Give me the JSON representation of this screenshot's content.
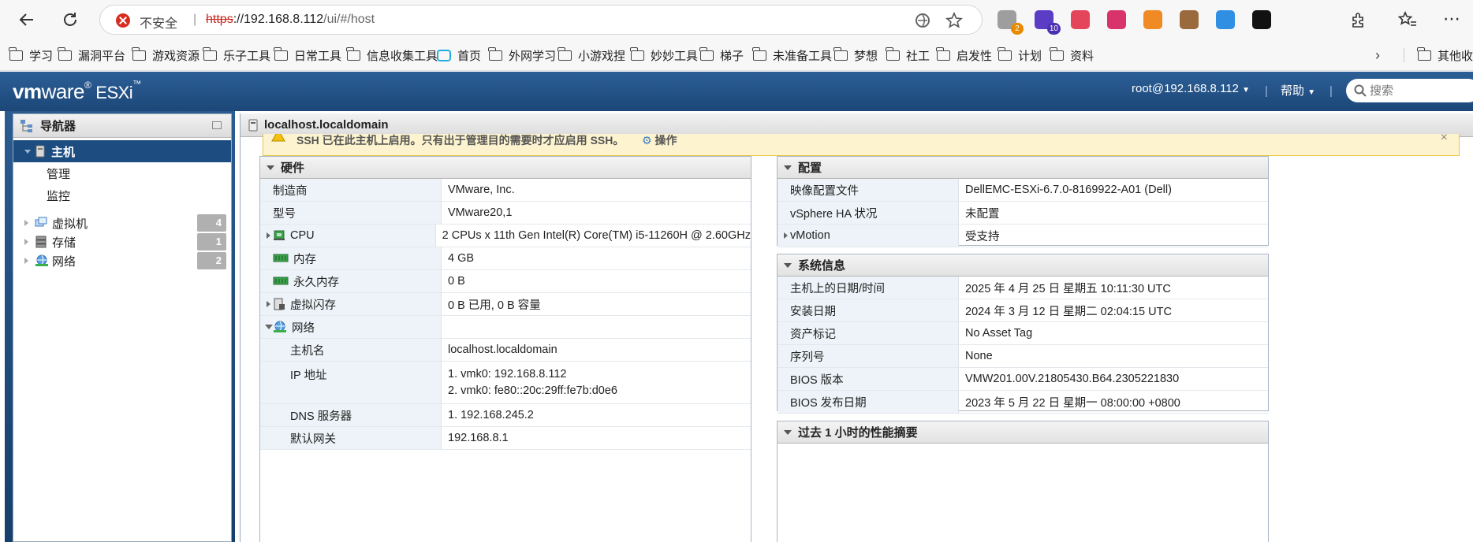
{
  "browser": {
    "insecure_label": "不安全",
    "url_scheme": "https",
    "url_host": "://192.168.8.112",
    "url_path": "/ui/#/host",
    "extensions": [
      {
        "name": "puzzle-gray",
        "badge": "2",
        "color": "#9e9e9e",
        "badge_color": "#e88a00"
      },
      {
        "name": "graduation",
        "badge": "10",
        "color": "#5b3cc4",
        "badge_color": "#4a2fb0"
      },
      {
        "name": "yd",
        "badge": "",
        "color": "#e5455a",
        "badge_color": ""
      },
      {
        "name": "translate",
        "badge": "",
        "color": "#d9336b",
        "badge_color": ""
      },
      {
        "name": "fox",
        "badge": "",
        "color": "#f08a24",
        "badge_color": ""
      },
      {
        "name": "cookie",
        "badge": "",
        "color": "#9a6a3c",
        "badge_color": ""
      },
      {
        "name": "pie",
        "badge": "",
        "color": "#2f8fe3",
        "badge_color": ""
      },
      {
        "name": "ghost",
        "badge": "",
        "color": "#111111",
        "badge_color": ""
      }
    ]
  },
  "bookmarks": [
    {
      "label": "学习",
      "icon": "folder"
    },
    {
      "label": "漏洞平台",
      "icon": "folder"
    },
    {
      "label": "游戏资源",
      "icon": "folder"
    },
    {
      "label": "乐子工具",
      "icon": "folder"
    },
    {
      "label": "日常工具",
      "icon": "folder"
    },
    {
      "label": "信息收集工具",
      "icon": "folder"
    },
    {
      "label": "首页",
      "icon": "bilibili"
    },
    {
      "label": "外网学习",
      "icon": "folder"
    },
    {
      "label": "小游戏捏",
      "icon": "folder"
    },
    {
      "label": "妙妙工具",
      "icon": "folder"
    },
    {
      "label": "梯子",
      "icon": "folder"
    },
    {
      "label": "未准备工具",
      "icon": "folder"
    },
    {
      "label": "梦想",
      "icon": "folder"
    },
    {
      "label": "社工",
      "icon": "folder"
    },
    {
      "label": "启发性",
      "icon": "folder"
    },
    {
      "label": "计划",
      "icon": "folder"
    },
    {
      "label": "资料",
      "icon": "folder"
    }
  ],
  "bookmarks_other": "其他收藏夹",
  "esxi": {
    "logo_vm": "vm",
    "logo_ware": "ware",
    "logo_product": "ESXi",
    "user": "root@192.168.8.112",
    "help": "帮助",
    "search_placeholder": "搜索"
  },
  "navigator": {
    "title": "导航器",
    "host": "主机",
    "host_children": [
      "管理",
      "监控"
    ],
    "items": [
      {
        "label": "虚拟机",
        "count": "4",
        "icon": "vm-icon"
      },
      {
        "label": "存储",
        "count": "1",
        "icon": "storage-icon"
      },
      {
        "label": "网络",
        "count": "2",
        "icon": "network-icon"
      }
    ]
  },
  "content": {
    "title": "localhost.localdomain",
    "warning": "SSH 已在此主机上启用。只有出于管理目的需要时才应启用 SSH。",
    "warning_action": "操作"
  },
  "hardware": {
    "title": "硬件",
    "rows": [
      {
        "key": "制造商",
        "value": "VMware, Inc."
      },
      {
        "key": "型号",
        "value": "VMware20,1"
      },
      {
        "key": "CPU",
        "value": "2 CPUs x 11th Gen Intel(R) Core(TM) i5-11260H @ 2.60GHz"
      },
      {
        "key": "内存",
        "value": "4 GB"
      },
      {
        "key": "永久内存",
        "value": "0 B"
      },
      {
        "key": "虚拟闪存",
        "value": "0 B 已用, 0 B 容量"
      },
      {
        "key": "网络",
        "value": ""
      },
      {
        "key": "主机名",
        "value": "localhost.localdomain"
      },
      {
        "key": "IP 地址",
        "value": "1. vmk0: 192.168.8.112",
        "value2": "2. vmk0: fe80::20c:29ff:fe7b:d0e6"
      },
      {
        "key": "DNS 服务器",
        "value": "1. 192.168.245.2"
      },
      {
        "key": "默认网关",
        "value": "192.168.8.1"
      }
    ]
  },
  "config": {
    "title": "配置",
    "rows": [
      {
        "key": "映像配置文件",
        "value": "DellEMC-ESXi-6.7.0-8169922-A01 (Dell)"
      },
      {
        "key": "vSphere HA 状况",
        "value": "未配置"
      },
      {
        "key": "vMotion",
        "value": "受支持"
      }
    ]
  },
  "sysinfo": {
    "title": "系统信息",
    "rows": [
      {
        "key": "主机上的日期/时间",
        "value": "2025 年 4 月 25 日 星期五 10:11:30 UTC"
      },
      {
        "key": "安装日期",
        "value": "2024 年 3 月 12 日 星期二 02:04:15 UTC"
      },
      {
        "key": "资产标记",
        "value": "No Asset Tag"
      },
      {
        "key": "序列号",
        "value": "None"
      },
      {
        "key": "BIOS 版本",
        "value": "VMW201.00V.21805430.B64.2305221830"
      },
      {
        "key": "BIOS 发布日期",
        "value": "2023 年 5 月 22 日 星期一 08:00:00 +0800"
      }
    ]
  },
  "perf": {
    "title": "过去 1 小时的性能摘要"
  }
}
